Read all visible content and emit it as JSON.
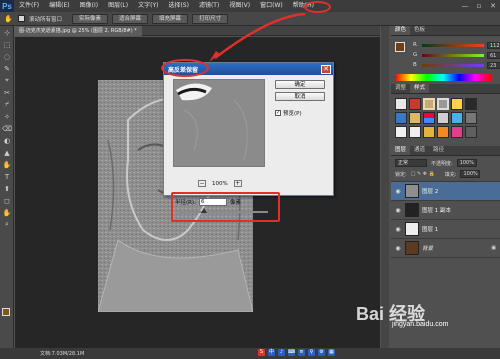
{
  "app": {
    "logo": "Ps"
  },
  "menu": [
    "文件(F)",
    "编辑(E)",
    "图像(I)",
    "图层(L)",
    "文字(Y)",
    "选择(S)",
    "滤镜(T)",
    "视图(V)",
    "窗口(W)",
    "帮助(H)"
  ],
  "window_controls": [
    "—",
    "▫",
    "✕"
  ],
  "options": {
    "checkbox_label": "滚动所有窗口",
    "buttons": [
      "实际像素",
      "适合屏幕",
      "填充屏幕",
      "打印尺寸"
    ]
  },
  "document": {
    "tab_title": "图-迈克杰克逊素描.jpg @ 25% (图层 2, RGB/8#) *"
  },
  "tools": [
    "⊹",
    "⬚",
    "◌",
    "✎",
    "⌖",
    "✂",
    "⌿",
    "✧",
    "⌫",
    "◐",
    "▲",
    "✋",
    "T",
    "⬆",
    "◻",
    "✋",
    "⌕"
  ],
  "status": {
    "doc_info": "文档:7.03M/28.1M"
  },
  "panels": {
    "color": {
      "tabs": [
        "颜色",
        "色板"
      ],
      "sliders": [
        {
          "label": "R",
          "value": "112"
        },
        {
          "label": "G",
          "value": "61"
        },
        {
          "label": "B",
          "value": "23"
        }
      ]
    },
    "adjust": {
      "tabs": [
        "调整",
        "样式"
      ]
    },
    "layers": {
      "tabs": [
        "图层",
        "通道",
        "路径"
      ],
      "blend_mode": "正常",
      "opacity_label": "不透明度:",
      "opacity_value": "100%",
      "lock_label": "锁定:",
      "fill_label": "填充:",
      "fill_value": "100%",
      "items": [
        {
          "name": "图层 2",
          "selected": true
        },
        {
          "name": "图层 1 副本",
          "selected": false
        },
        {
          "name": "图层 1",
          "selected": false
        },
        {
          "name": "背景",
          "selected": false
        }
      ]
    }
  },
  "dialog": {
    "title": "高反差保留",
    "close": "✕",
    "buttons": {
      "ok": "确定",
      "cancel": "取消"
    },
    "preview_checkbox": "预览(P)",
    "zoom": {
      "minus": "−",
      "level": "100%",
      "plus": "+"
    },
    "radius": {
      "label": "半径(R):",
      "value": "6",
      "unit": "像素"
    }
  },
  "watermark": {
    "text": "Bai 经验",
    "url": "jingyan.baidu.com"
  },
  "tray": [
    "S",
    "中",
    "♪",
    "⌨",
    "≡",
    "♀",
    "⚙",
    "▦"
  ]
}
